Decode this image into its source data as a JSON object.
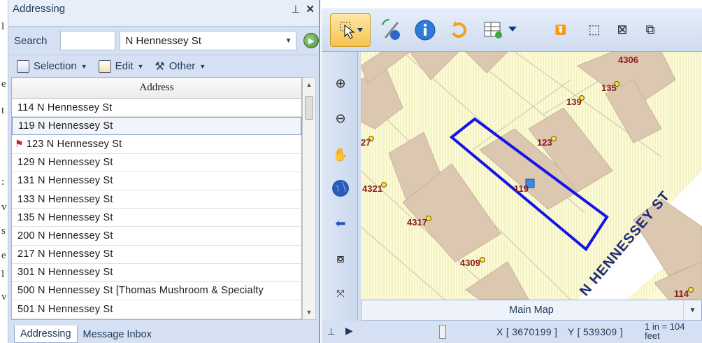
{
  "addressing": {
    "title": "Addressing",
    "pin_glyph": "⊥",
    "close_glyph": "✕",
    "search_label": "Search",
    "search_value": "",
    "selected_street": "N Hennessey St",
    "toolbar": {
      "selection": "Selection",
      "edit": "Edit",
      "other": "Other"
    },
    "grid_header": "Address",
    "rows": [
      "114 N Hennessey St",
      "119 N Hennessey St",
      "123 N Hennessey St",
      "129 N Hennessey St",
      "131 N Hennessey St",
      "133 N Hennessey St",
      "135 N Hennessey St",
      "200 N Hennessey St",
      "217 N Hennessey St",
      "301 N Hennessey St",
      "500 N Hennessey St [Thomas Mushroom & Specialty",
      "501 N Hennessey St"
    ],
    "selected_row": "119 N Hennessey St",
    "flagged_row": "123 N Hennessey St",
    "tabs": [
      "Addressing",
      "Message Inbox"
    ],
    "active_tab": "Addressing"
  },
  "map": {
    "street_label": "N HENNESSEY ST",
    "parcel_labels": [
      "4306",
      "135",
      "139",
      "27",
      "123",
      "119",
      "4321",
      "4317",
      "4309",
      "114"
    ],
    "map_name": "Main Map",
    "x_coord": "X [ 3670199 ]",
    "y_coord": "Y [ 539309 ]",
    "scale_line1": "1 in = 104",
    "scale_line2": "feet"
  },
  "colors": {
    "selection_outline": "#1414e6",
    "building": "#dcc7b0",
    "parcel_fill": "#fbfbdc",
    "road": "#ffffff",
    "label": "#8b1a1a",
    "point": "#f7e04b",
    "street_label": "#1e2a78"
  },
  "edge_chars": [
    "l",
    "e",
    "t",
    ":",
    "v",
    "s",
    "e",
    "l",
    "v"
  ]
}
